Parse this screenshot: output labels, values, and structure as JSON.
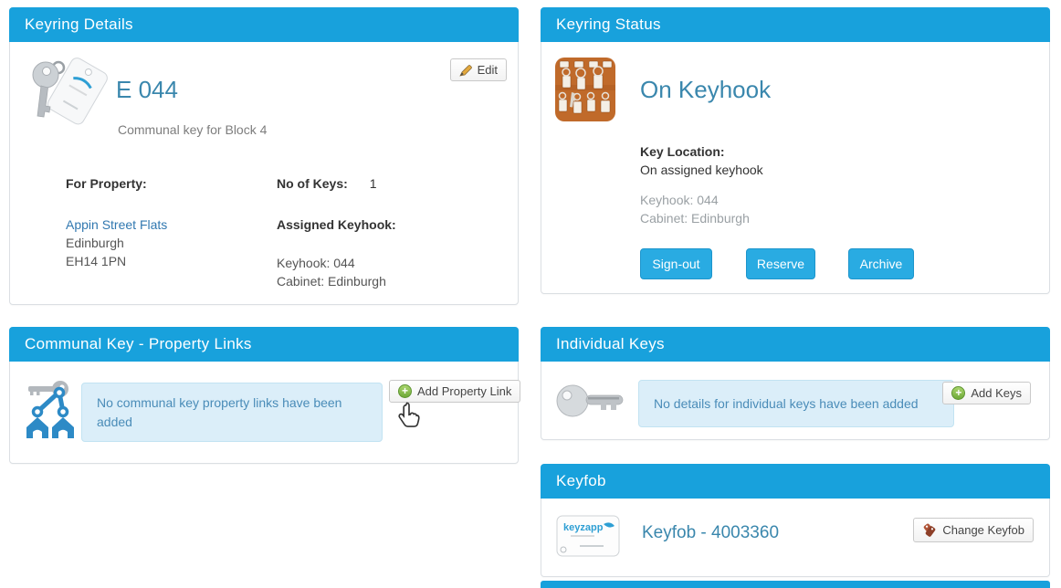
{
  "colors": {
    "header_bg": "#18a1dc",
    "button_primary_bg": "#29abe2",
    "heading_text": "#3a87ad",
    "info_bg": "#dbeef9",
    "info_border": "#c2e3f2",
    "info_text": "#4a8cb8"
  },
  "panels": {
    "keyring_details": {
      "title": "Keyring Details",
      "edit_label": "Edit",
      "name": "E 044",
      "description": "Communal key for Block 4",
      "for_property_label": "For Property:",
      "property_name": "Appin Street Flats",
      "property_city": "Edinburgh",
      "property_postcode": "EH14 1PN",
      "no_of_keys_label": "No of Keys:",
      "no_of_keys_value": "1",
      "assigned_keyhook_label": "Assigned Keyhook:",
      "keyhook_line": "Keyhook: 044",
      "cabinet_line": "Cabinet: Edinburgh"
    },
    "keyring_status": {
      "title": "Keyring Status",
      "status_heading": "On Keyhook",
      "key_location_label": "Key Location:",
      "key_location_value": "On assigned keyhook",
      "keyhook_line": "Keyhook: 044",
      "cabinet_line": "Cabinet: Edinburgh",
      "sign_out_label": "Sign-out",
      "reserve_label": "Reserve",
      "archive_label": "Archive"
    },
    "property_links": {
      "title": "Communal Key - Property Links",
      "empty_message": "No communal key property links have been added",
      "add_label": "Add Property Link"
    },
    "individual_keys": {
      "title": "Individual Keys",
      "empty_message": "No details for individual keys have been added",
      "add_label": "Add Keys"
    },
    "keyfob": {
      "title": "Keyfob",
      "label": "Keyfob - 4003360",
      "change_label": "Change Keyfob",
      "brand": "keyzapp"
    }
  }
}
